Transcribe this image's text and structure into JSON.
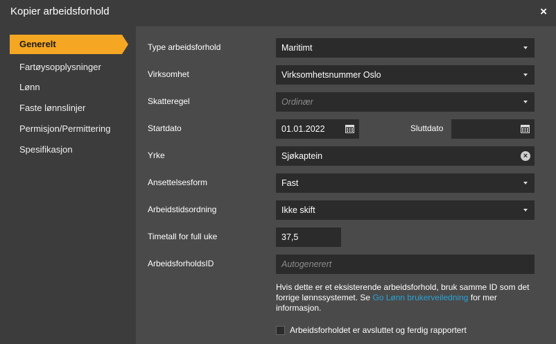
{
  "window": {
    "title": "Kopier arbeidsforhold",
    "close": "×"
  },
  "sidebar": {
    "items": [
      {
        "label": "Generelt"
      },
      {
        "label": "Fartøysopplysninger"
      },
      {
        "label": "Lønn"
      },
      {
        "label": "Faste lønnslinjer"
      },
      {
        "label": "Permisjon/Permittering"
      },
      {
        "label": "Spesifikasjon"
      }
    ]
  },
  "form": {
    "type_label": "Type arbeidsforhold",
    "type_value": "Maritimt",
    "virksomhet_label": "Virksomhet",
    "virksomhet_value": "Virksomhetsnummer Oslo",
    "skatteregel_label": "Skatteregel",
    "skatteregel_placeholder": "Ordinær",
    "startdato_label": "Startdato",
    "startdato_value": "01.01.2022",
    "sluttdato_label": "Sluttdato",
    "sluttdato_value": "",
    "yrke_label": "Yrke",
    "yrke_value": "Sjøkaptein",
    "ansettelsesform_label": "Ansettelsesform",
    "ansettelsesform_value": "Fast",
    "arbeidstid_label": "Arbeidstidsordning",
    "arbeidstid_value": "Ikke skift",
    "timetall_label": "Timetall for full uke",
    "timetall_value": "37,5",
    "id_label": "ArbeidsforholdsID",
    "id_placeholder": "Autogenerert",
    "info_text_1": "Hvis dette er et eksisterende arbeidsforhold, bruk samme ID som det forrige lønnssystemet. Se ",
    "info_link": "Go Lønn brukerveiledning",
    "info_text_2": " for mer informasjon.",
    "checkbox_label": "Arbeidsforholdet er avsluttet og ferdig rapportert"
  },
  "colors": {
    "accent": "#f5a623",
    "link": "#29a3d6",
    "field_bg": "#2b2b2b",
    "panel_bg": "#4a4a4a"
  },
  "icons": [
    "close-icon",
    "chevron-down-icon",
    "calendar-icon",
    "clear-icon"
  ]
}
